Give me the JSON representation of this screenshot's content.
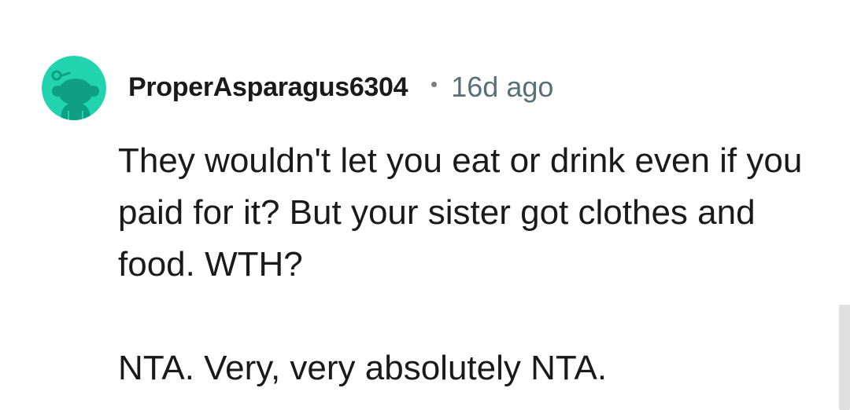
{
  "comment": {
    "author": "ProperAsparagus6304",
    "separator": "•",
    "age": "16d ago",
    "paragraphs": [
      "They wouldn't let you eat or drink even if you paid for it? But your sister got clothes and food. WTH?",
      "NTA. Very, very absolutely NTA."
    ],
    "avatar_icon": "reddit-snoo-avatar-icon"
  },
  "colors": {
    "avatar_background": "#22d3b0",
    "avatar_figure": "#0e9f84",
    "username": "#1a1a1b",
    "timestamp": "#576f76",
    "body_text": "#1a1a1b",
    "scrollbar": "#e0e0e0"
  }
}
